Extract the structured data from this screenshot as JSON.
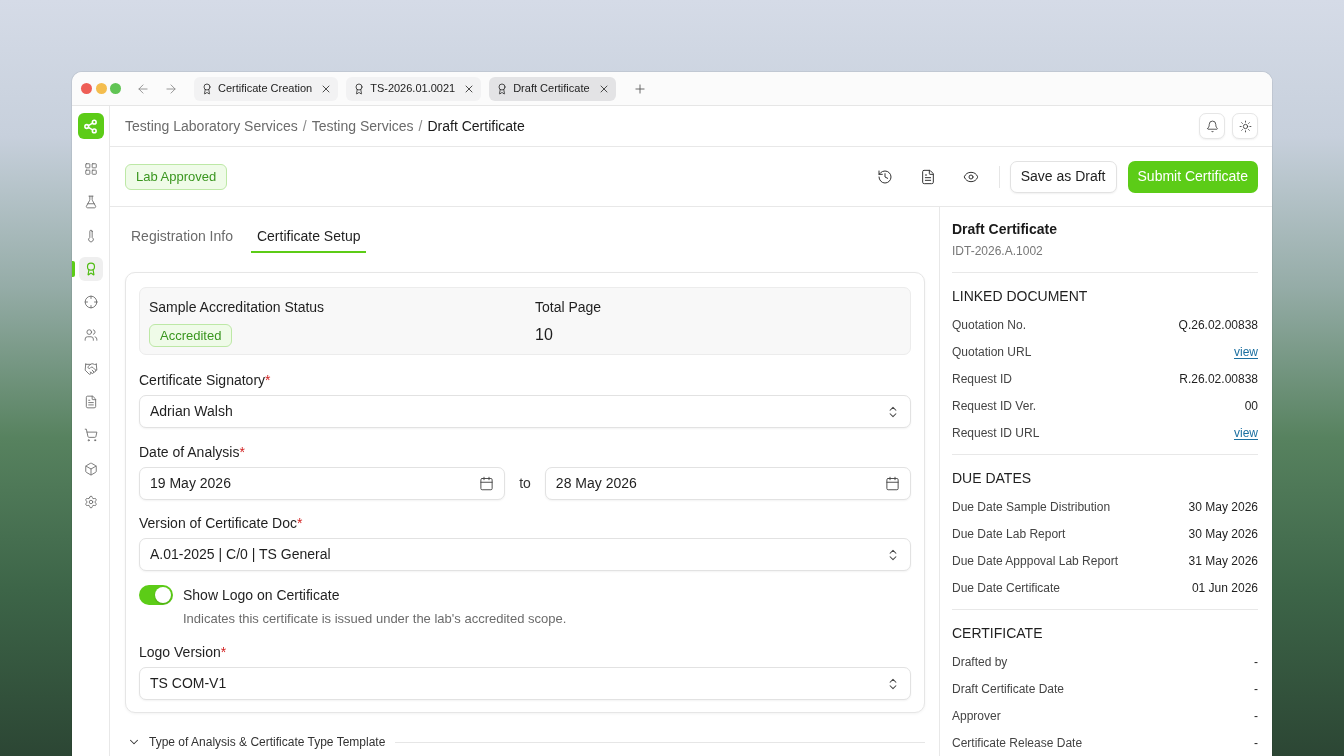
{
  "browser": {
    "tabs": [
      {
        "label": "Certificate Creation",
        "selected": false
      },
      {
        "label": "TS-2026.01.0021",
        "selected": false
      },
      {
        "label": "Draft Certificate",
        "selected": true
      }
    ]
  },
  "sidebar": {
    "items": [
      {
        "selected": false
      },
      {
        "selected": false
      },
      {
        "selected": false
      },
      {
        "selected": true
      },
      {
        "selected": false
      },
      {
        "selected": false
      },
      {
        "selected": false
      },
      {
        "selected": false
      },
      {
        "selected": false
      },
      {
        "selected": false
      },
      {
        "selected": false
      }
    ]
  },
  "breadcrumb": [
    {
      "kind": "link",
      "label": "Testing Laboratory Services"
    },
    {
      "kind": "separator",
      "label": "/"
    },
    {
      "kind": "link",
      "label": "Testing Services"
    },
    {
      "kind": "separator",
      "label": "/"
    },
    {
      "kind": "current",
      "label": "Draft Certificate"
    }
  ],
  "toolbar": {
    "status": "Lab Approved",
    "buttons": [
      {
        "label": "Save as Draft",
        "kind": "secondary"
      },
      {
        "label": "Submit Certificate",
        "kind": "primary"
      }
    ]
  },
  "tabs": [
    {
      "label": "Registration Info",
      "selected": false
    },
    {
      "label": "Certificate Setup",
      "selected": true
    }
  ],
  "form": {
    "accreditation": {
      "label": "Sample Accreditation Status",
      "badge": "Accredited"
    },
    "total_page": {
      "label": "Total Page",
      "value": "10"
    },
    "signatory": {
      "label": "Certificate Signatory",
      "required_mark": "*",
      "value": "Adrian Walsh"
    },
    "date_of_analysis": {
      "label": "Date of Analysis",
      "required_mark": "*",
      "from": "19 May 2026",
      "joiner": "to",
      "to": "28 May 2026"
    },
    "version": {
      "label": "Version of Certificate Doc",
      "required_mark": "*",
      "value": "A.01-2025 | C/0 | TS General"
    },
    "show_logo": {
      "label": "Show Logo on Certificate",
      "description": "Indicates this certificate is issued under the lab's accredited scope.",
      "on": true
    },
    "logo_version": {
      "label": "Logo Version",
      "required_mark": "*",
      "value": "TS COM-V1"
    }
  },
  "section": {
    "title": "Type of Analysis & Certificate Type Template"
  },
  "summary": {
    "title": "Draft Certificate",
    "id": "IDT-2026.A.1002",
    "sections": [
      {
        "heading": "LINKED DOCUMENT",
        "rows": [
          {
            "label": "Quotation No.",
            "value": "Q.26.02.00838",
            "kind": "text"
          },
          {
            "label": "Quotation URL",
            "value": "view",
            "kind": "link"
          },
          {
            "label": "Request ID",
            "value": "R.26.02.00838",
            "kind": "text"
          },
          {
            "label": "Request ID Ver.",
            "value": "00",
            "kind": "text"
          },
          {
            "label": "Request ID URL",
            "value": "view",
            "kind": "link"
          }
        ]
      },
      {
        "heading": "DUE DATES",
        "rows": [
          {
            "label": "Due Date Sample Distribution",
            "value": "30 May 2026",
            "kind": "text"
          },
          {
            "label": "Due Date Lab Report",
            "value": "30 May 2026",
            "kind": "text"
          },
          {
            "label": "Due Date Apppoval Lab Report",
            "value": "31 May 2026",
            "kind": "text"
          },
          {
            "label": "Due Date Certificate",
            "value": "01 Jun 2026",
            "kind": "text"
          }
        ]
      },
      {
        "heading": "CERTIFICATE",
        "rows": [
          {
            "label": "Drafted by",
            "value": "-",
            "kind": "text"
          },
          {
            "label": "Draft Certificate Date",
            "value": "-",
            "kind": "text"
          },
          {
            "label": "Approver",
            "value": "-",
            "kind": "text"
          },
          {
            "label": "Certificate Release Date",
            "value": "-",
            "kind": "text"
          }
        ]
      }
    ]
  }
}
